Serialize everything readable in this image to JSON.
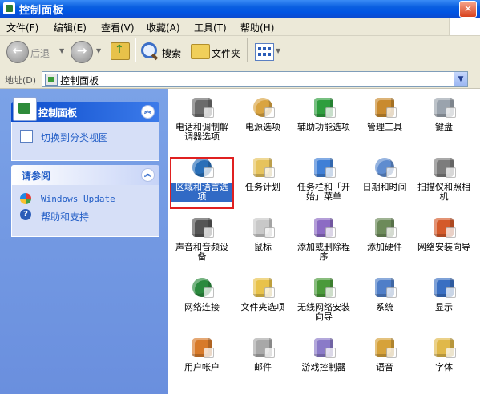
{
  "window": {
    "title": "控制面板",
    "close_glyph": "✕"
  },
  "menu": [
    "文件(F)",
    "编辑(E)",
    "查看(V)",
    "收藏(A)",
    "工具(T)",
    "帮助(H)"
  ],
  "toolbar": {
    "back_label": "后退",
    "back_glyph": "←",
    "forward_glyph": "→",
    "up_glyph": "↑",
    "search_label": "搜索",
    "folders_label": "文件夹",
    "dropdown_glyph": "▼"
  },
  "address": {
    "label": "地址(D)",
    "value": "控制面板",
    "dropdown_glyph": "▼"
  },
  "sidebar": {
    "panel1": {
      "title": "控制面板",
      "link": "切换到分类视图",
      "chevron": "︽"
    },
    "panel2": {
      "title": "请参阅",
      "chevron": "︽",
      "links": [
        "Windows Update",
        "帮助和支持"
      ]
    }
  },
  "items": [
    {
      "label": "电话和调制解调器选项",
      "icon": "phone-modem-icon",
      "color": "#6b6b6b"
    },
    {
      "label": "电源选项",
      "icon": "power-options-icon",
      "color": "#d9a441"
    },
    {
      "label": "辅助功能选项",
      "icon": "accessibility-icon",
      "color": "#2e9e3e"
    },
    {
      "label": "管理工具",
      "icon": "admin-tools-icon",
      "color": "#c98a2e"
    },
    {
      "label": "键盘",
      "icon": "keyboard-icon",
      "color": "#9aa3ad"
    },
    {
      "label": "区域和语言选项",
      "icon": "globe-icon",
      "color": "#2a6fb8"
    },
    {
      "label": "任务计划",
      "icon": "scheduled-tasks-icon",
      "color": "#e6c35c"
    },
    {
      "label": "任务栏和「开始」菜单",
      "icon": "taskbar-icon",
      "color": "#3f7fd6"
    },
    {
      "label": "日期和时间",
      "icon": "clock-icon",
      "color": "#5f8ccf"
    },
    {
      "label": "扫描仪和照相机",
      "icon": "scanner-camera-icon",
      "color": "#7c7c7c"
    },
    {
      "label": "声音和音频设备",
      "icon": "speaker-icon",
      "color": "#555555"
    },
    {
      "label": "鼠标",
      "icon": "mouse-icon",
      "color": "#c8c8c8"
    },
    {
      "label": "添加或删除程序",
      "icon": "add-remove-programs-icon",
      "color": "#8c6bc4"
    },
    {
      "label": "添加硬件",
      "icon": "add-hardware-icon",
      "color": "#6c8a5a"
    },
    {
      "label": "网络安装向导",
      "icon": "network-wizard-icon",
      "color": "#d45a2a"
    },
    {
      "label": "网络连接",
      "icon": "network-connections-icon",
      "color": "#2b8a3e"
    },
    {
      "label": "文件夹选项",
      "icon": "folder-options-icon",
      "color": "#e8c24a"
    },
    {
      "label": "无线网络安装向导",
      "icon": "wireless-icon",
      "color": "#4a9a3a"
    },
    {
      "label": "系统",
      "icon": "system-icon",
      "color": "#4f7ec8"
    },
    {
      "label": "显示",
      "icon": "display-icon",
      "color": "#3a6fc2"
    },
    {
      "label": "用户帐户",
      "icon": "user-accounts-icon",
      "color": "#d77a2a"
    },
    {
      "label": "邮件",
      "icon": "mail-icon",
      "color": "#a8a8a8"
    },
    {
      "label": "游戏控制器",
      "icon": "game-controller-icon",
      "color": "#8a7ac8"
    },
    {
      "label": "语音",
      "icon": "speech-icon",
      "color": "#d6a23a"
    },
    {
      "label": "字体",
      "icon": "fonts-icon",
      "color": "#e0b84a"
    }
  ]
}
